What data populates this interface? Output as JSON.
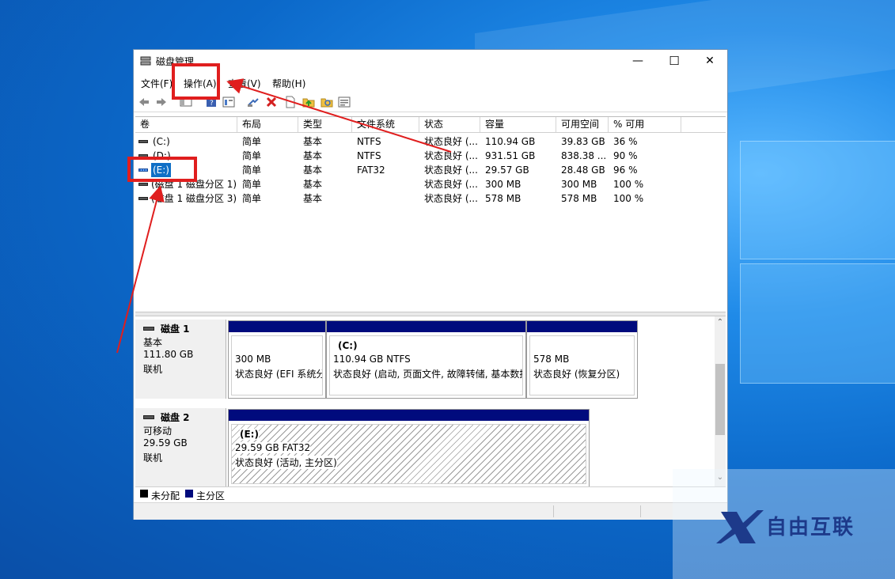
{
  "window": {
    "title": "磁盘管理",
    "controls": {
      "minimize": "—",
      "maximize": "☐",
      "close": "✕"
    }
  },
  "menu": [
    "文件(F)",
    "操作(A)",
    "查看(V)",
    "帮助(H)"
  ],
  "columns": [
    "卷",
    "布局",
    "类型",
    "文件系统",
    "状态",
    "容量",
    "可用空间",
    "% 可用"
  ],
  "volumes": [
    {
      "name": "(C:)",
      "layout": "简单",
      "type": "基本",
      "fs": "NTFS",
      "status": "状态良好 (...",
      "capacity": "110.94 GB",
      "free": "39.83 GB",
      "pct": "36 %"
    },
    {
      "name": "(D:)",
      "layout": "简单",
      "type": "基本",
      "fs": "NTFS",
      "status": "状态良好 (...",
      "capacity": "931.51 GB",
      "free": "838.38 ...",
      "pct": "90 %"
    },
    {
      "name": "(E:)",
      "layout": "简单",
      "type": "基本",
      "fs": "FAT32",
      "status": "状态良好 (...",
      "capacity": "29.57 GB",
      "free": "28.48 GB",
      "pct": "96 %"
    },
    {
      "name": "(磁盘 1 磁盘分区 1)",
      "layout": "简单",
      "type": "基本",
      "fs": "",
      "status": "状态良好 (...",
      "capacity": "300 MB",
      "free": "300 MB",
      "pct": "100 %"
    },
    {
      "name": "(磁盘 1 磁盘分区 3)",
      "layout": "简单",
      "type": "基本",
      "fs": "",
      "status": "状态良好 (...",
      "capacity": "578 MB",
      "free": "578 MB",
      "pct": "100 %"
    }
  ],
  "disks": [
    {
      "name": "磁盘 1",
      "kind": "基本",
      "size": "111.80 GB",
      "state": "联机",
      "partitions": [
        {
          "label": "",
          "line1": "300 MB",
          "line2": "状态良好 (EFI 系统分"
        },
        {
          "label": "(C:)",
          "line1": "110.94 GB NTFS",
          "line2": "状态良好 (启动, 页面文件, 故障转储, 基本数据"
        },
        {
          "label": "",
          "line1": "578 MB",
          "line2": "状态良好 (恢复分区)"
        }
      ]
    },
    {
      "name": "磁盘 2",
      "kind": "可移动",
      "size": "29.59 GB",
      "state": "联机",
      "partitions": [
        {
          "label": "(E:)",
          "line1": "29.59 GB FAT32",
          "line2": "状态良好 (活动, 主分区)"
        }
      ]
    }
  ],
  "legend": [
    {
      "label": "未分配",
      "color": "#000000"
    },
    {
      "label": "主分区",
      "color": "#000b7d"
    }
  ],
  "toolbar_icons": [
    "back-icon",
    "forward-icon",
    "show-hide-console-icon",
    "help-book-icon",
    "properties-icon",
    "connect-icon",
    "delete-icon",
    "new-doc-icon",
    "folder-up-icon",
    "folder-search-icon",
    "settings-list-icon"
  ],
  "watermark": {
    "text": "自由互联"
  },
  "colors": {
    "partition_bar": "#000b7d",
    "selection": "#0f6fc6",
    "highlight": "#e01e1e"
  }
}
